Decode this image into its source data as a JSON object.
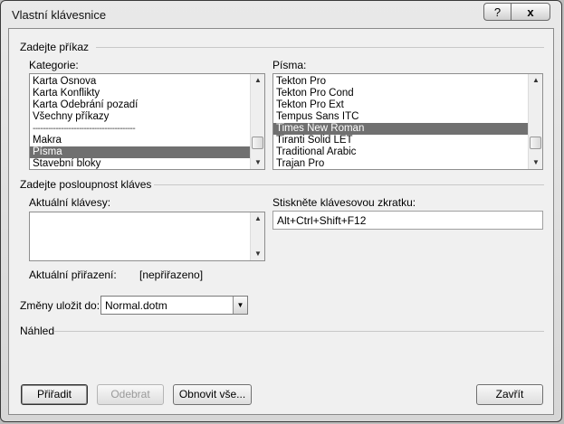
{
  "window": {
    "title": "Vlastní klávesnice",
    "help_label": "?",
    "close_label": "x"
  },
  "command_section": {
    "title": "Zadejte příkaz",
    "categories_label": "Kategorie:",
    "categories": [
      {
        "label": "Karta Osnova"
      },
      {
        "label": "Karta Konflikty"
      },
      {
        "label": "Karta Odebrání pozadí"
      },
      {
        "label": "Všechny příkazy"
      },
      {
        "label": "----------------------------------------"
      },
      {
        "label": "Makra"
      },
      {
        "label": "Písma"
      },
      {
        "label": "Stavební bloky"
      }
    ],
    "categories_selected": "Písma",
    "fonts_label": "Písma:",
    "fonts": [
      {
        "label": "Tekton Pro"
      },
      {
        "label": "Tekton Pro Cond"
      },
      {
        "label": "Tekton Pro Ext"
      },
      {
        "label": "Tempus Sans ITC"
      },
      {
        "label": "Times New Roman"
      },
      {
        "label": "Tiranti Solid LET"
      },
      {
        "label": "Traditional Arabic"
      },
      {
        "label": "Trajan Pro"
      }
    ],
    "fonts_selected": "Times New Roman"
  },
  "keys_section": {
    "title": "Zadejte posloupnost kláves",
    "current_keys_label": "Aktuální klávesy:",
    "shortcut_label": "Stiskněte klávesovou zkratku:",
    "shortcut_value": "Alt+Ctrl+Shift+F12",
    "assignment_label": "Aktuální přiřazení:",
    "assignment_value": "[nepřiřazeno]"
  },
  "save_in": {
    "label": "Změny uložit do:",
    "value": "Normal.dotm"
  },
  "preview": {
    "title": "Náhled"
  },
  "buttons": {
    "assign": "Přiřadit",
    "remove": "Odebrat",
    "reset_all": "Obnovit vše...",
    "close": "Zavřít"
  }
}
